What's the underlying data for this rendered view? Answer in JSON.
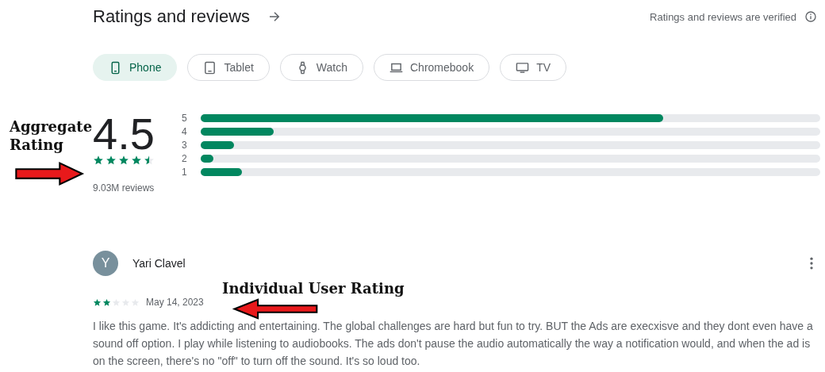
{
  "header": {
    "title": "Ratings and reviews",
    "verified": "Ratings and reviews are verified"
  },
  "devices": [
    {
      "label": "Phone",
      "kind": "phone",
      "selected": true
    },
    {
      "label": "Tablet",
      "kind": "tablet",
      "selected": false
    },
    {
      "label": "Watch",
      "kind": "watch",
      "selected": false
    },
    {
      "label": "Chromebook",
      "kind": "laptop",
      "selected": false
    },
    {
      "label": "TV",
      "kind": "tv",
      "selected": false
    }
  ],
  "summary": {
    "score": "4.5",
    "stars": 4.5,
    "reviews": "9.03M reviews",
    "bars": [
      {
        "label": "5",
        "level": 0.746
      },
      {
        "label": "4",
        "level": 0.118
      },
      {
        "label": "3",
        "level": 0.054
      },
      {
        "label": "2",
        "level": 0.02
      },
      {
        "label": "1",
        "level": 0.066
      }
    ]
  },
  "review": {
    "initial": "Y",
    "author": "Yari Clavel",
    "stars": 2,
    "date": "May 14, 2023",
    "text": "I like this game. It's addicting and entertaining. The global challenges are hard but fun to try. BUT the Ads are execxisve and they dont even have a sound off option. I play while listening to audiobooks. The ads don't pause the audio automatically the way a notification would, and when the ad is on the screen, there's no \"off\" to turn off the sound. It's so loud too."
  },
  "annotations": [
    {
      "text": "Aggregate Rating",
      "kind": "right"
    },
    {
      "text": "Individual User Rating",
      "kind": "left"
    }
  ]
}
